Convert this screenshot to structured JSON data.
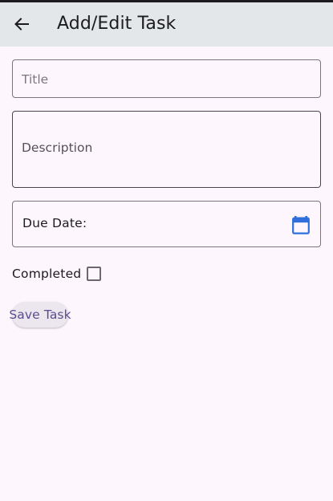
{
  "app_bar": {
    "title": "Add/Edit Task",
    "back_icon": "arrow-back-icon"
  },
  "form": {
    "title_placeholder": "Title",
    "description_placeholder": "Description",
    "due_date_label": "Due Date:",
    "due_date_icon": "calendar-icon",
    "completed_label": "Completed",
    "completed_checked": false,
    "save_button_label": "Save Task"
  },
  "colors": {
    "background": "#fdf7fd",
    "app_bar": "#e4e7ea",
    "accent": "#2f6fdc",
    "button_text": "#5a4d8e",
    "button_bg": "#ece6ef"
  }
}
